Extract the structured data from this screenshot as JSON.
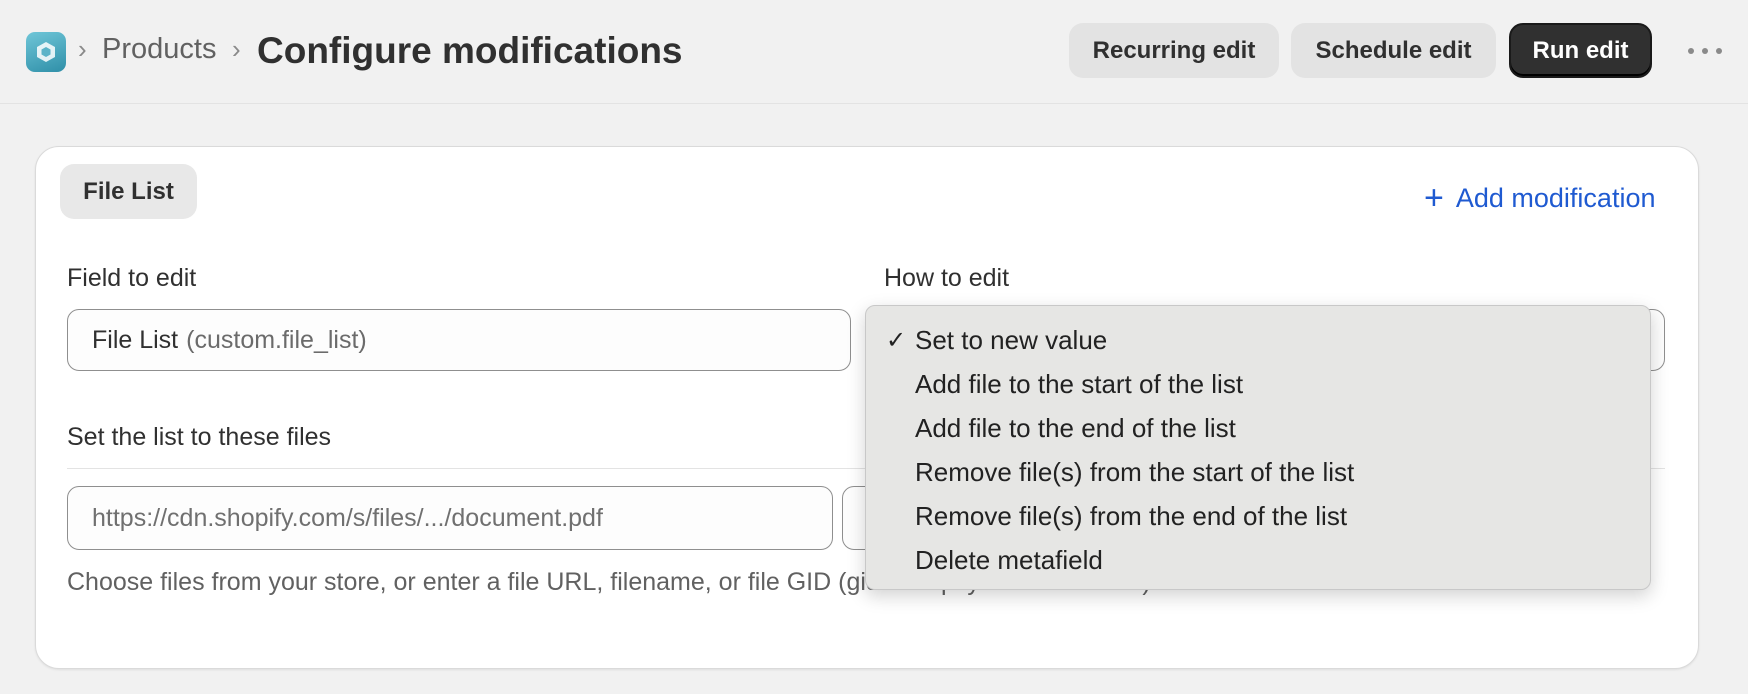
{
  "header": {
    "breadcrumb_parent": "Products",
    "breadcrumb_separator": "›",
    "title": "Configure modifications",
    "buttons": {
      "recurring": "Recurring edit",
      "schedule": "Schedule edit",
      "run": "Run edit"
    },
    "more_icon": "ellipsis-icon",
    "app_icon": "app-logo-icon"
  },
  "card": {
    "tag": "File List",
    "add_modification": "Add modification",
    "add_icon": "plus-icon",
    "field_to_edit": {
      "label": "Field to edit",
      "value": "File List",
      "key": "(custom.file_list)"
    },
    "how_to_edit": {
      "label": "How to edit"
    },
    "files": {
      "label": "Set the list to these files",
      "placeholder": "https://cdn.shopify.com/s/files/.../document.pdf",
      "help": "Choose files from your store, or enter a file URL, filename, or file GID (gid://shopify/GenericFile/...)."
    }
  },
  "dropdown": {
    "check": "✓",
    "selected_index": 0,
    "options": [
      "Set to new value",
      "Add file to the start of the list",
      "Add file to the end of the list",
      "Remove file(s) from the start of the list",
      "Remove file(s) from the end of the list",
      "Delete metafield"
    ]
  },
  "colors": {
    "accent": "#1f5ad1",
    "primary_button": "#303030",
    "background": "#f1f1f1"
  }
}
